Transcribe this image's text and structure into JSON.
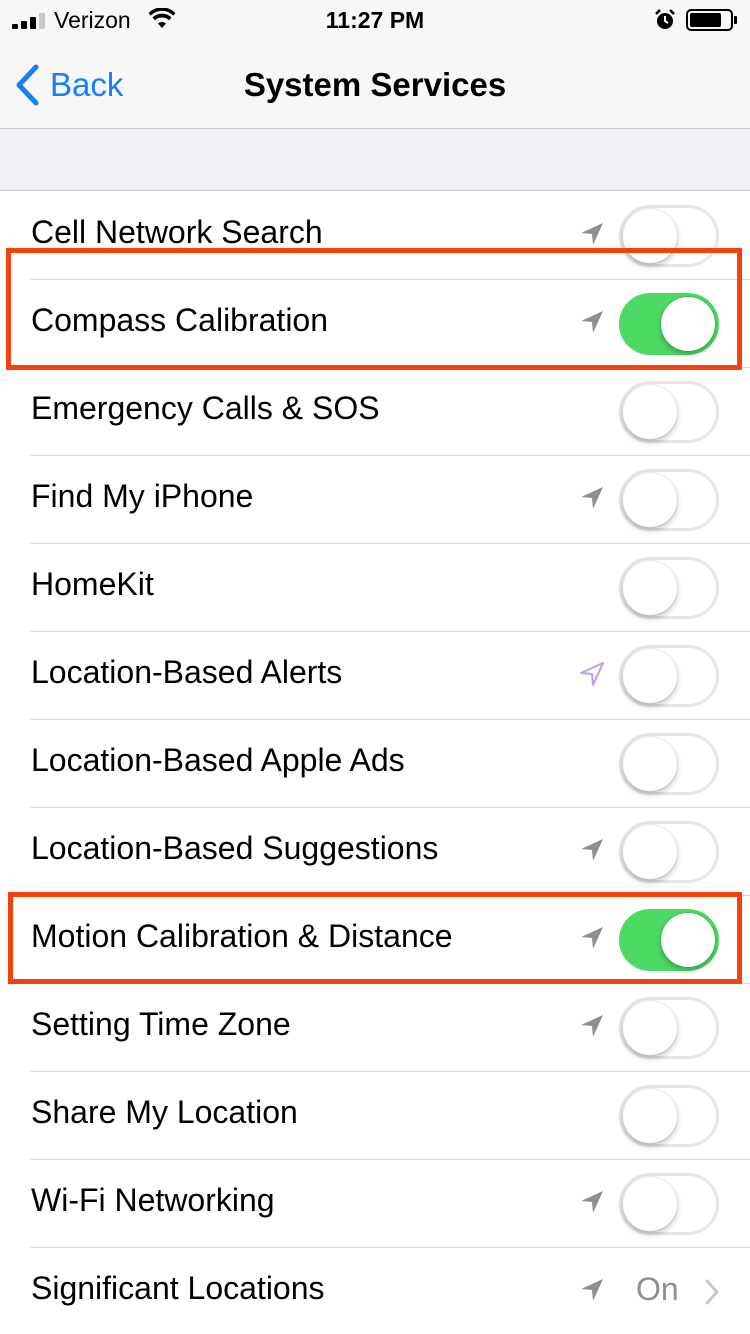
{
  "status_bar": {
    "carrier": "Verizon",
    "time": "11:27 PM",
    "signal_bars_filled": 3,
    "signal_bars_total": 4
  },
  "nav": {
    "back_label": "Back",
    "title": "System Services"
  },
  "colors": {
    "accent": "#157efb",
    "switch_on": "#4cd964",
    "highlight": "#f4420f",
    "location_gray": "#8e8e93",
    "location_purple": "#c09bf0"
  },
  "rows": [
    {
      "label": "Cell Network Search",
      "location_icon": "location-arrow-gray",
      "on": false
    },
    {
      "label": "Compass Calibration",
      "location_icon": "location-arrow-gray",
      "on": true
    },
    {
      "label": "Emergency Calls & SOS",
      "location_icon": null,
      "on": false
    },
    {
      "label": "Find My iPhone",
      "location_icon": "location-arrow-gray",
      "on": false
    },
    {
      "label": "HomeKit",
      "location_icon": null,
      "on": false
    },
    {
      "label": "Location-Based Alerts",
      "location_icon": "location-arrow-purple-outline",
      "on": false
    },
    {
      "label": "Location-Based Apple Ads",
      "location_icon": null,
      "on": false
    },
    {
      "label": "Location-Based Suggestions",
      "location_icon": "location-arrow-gray",
      "on": false
    },
    {
      "label": "Motion Calibration & Distance",
      "location_icon": "location-arrow-gray",
      "on": true
    },
    {
      "label": "Setting Time Zone",
      "location_icon": "location-arrow-gray",
      "on": false
    },
    {
      "label": "Share My Location",
      "location_icon": null,
      "on": false
    },
    {
      "label": "Wi-Fi Networking",
      "location_icon": "location-arrow-gray",
      "on": false
    },
    {
      "label": "Significant Locations",
      "location_icon": "location-arrow-gray",
      "value": "On",
      "disclosure": true
    }
  ]
}
